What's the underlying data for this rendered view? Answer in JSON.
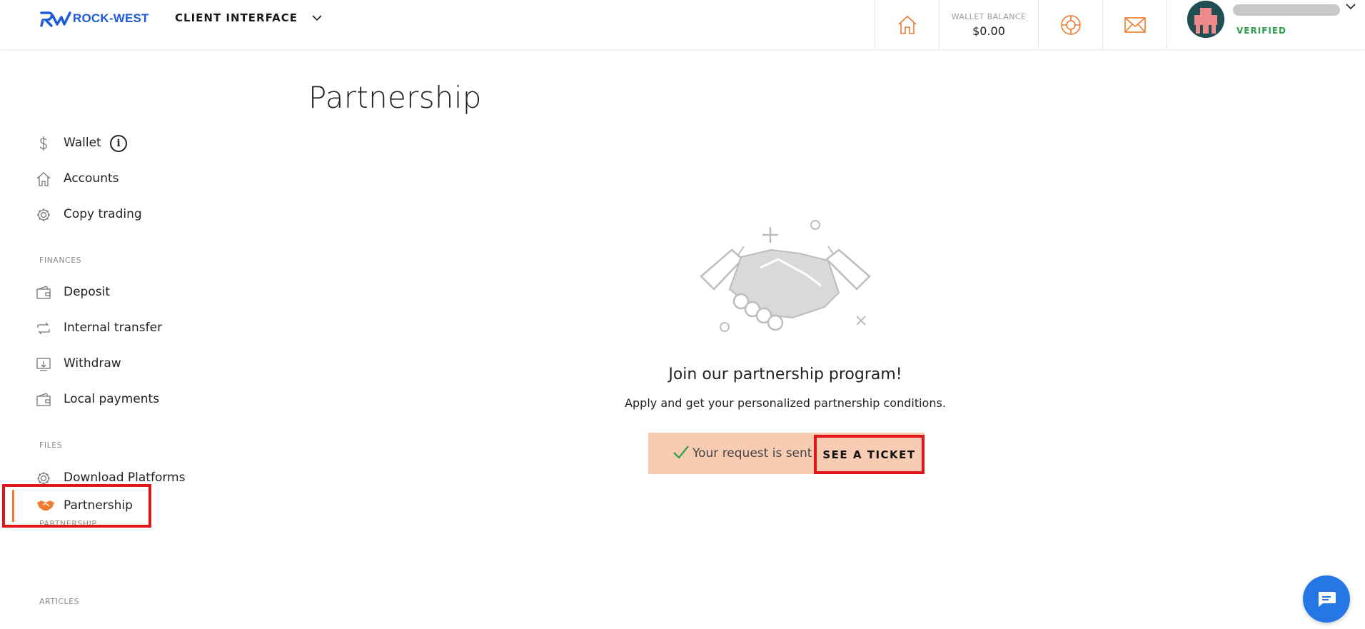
{
  "header": {
    "logo_text": "ROCK-WEST",
    "client_menu_label": "CLIENT INTERFACE",
    "wallet_label": "WALLET BALANCE",
    "wallet_value": "$0.00",
    "profile_status": "VERIFIED",
    "accent_color": "#f07a2e",
    "brand_color": "#1f5bd9"
  },
  "sidebar": {
    "items": [
      {
        "label": "Wallet",
        "icon": "dollar-icon"
      },
      {
        "label": "Accounts",
        "icon": "home-icon"
      },
      {
        "label": "Copy trading",
        "icon": "gear-icon"
      }
    ],
    "sections": {
      "finances": {
        "title": "FINANCES",
        "items": [
          {
            "label": "Deposit",
            "icon": "wallet-icon"
          },
          {
            "label": "Internal transfer",
            "icon": "transfer-icon"
          },
          {
            "label": "Withdraw",
            "icon": "withdraw-icon"
          },
          {
            "label": "Local payments",
            "icon": "wallet-icon"
          }
        ]
      },
      "files": {
        "title": "FILES",
        "items": [
          {
            "label": "Download Platforms",
            "icon": "gear-icon"
          }
        ]
      },
      "partnership": {
        "title": "PARTNERSHIP",
        "items": [
          {
            "label": "Partnership",
            "icon": "handshake-icon",
            "active": true
          }
        ]
      },
      "articles": {
        "title": "ARTICLES"
      }
    }
  },
  "main": {
    "title": "Partnership",
    "join_title": "Join our partnership program!",
    "join_subtitle": "Apply and get your personalized partnership conditions.",
    "banner_text": "Your request is sent",
    "ticket_button": "SEE A TICKET"
  }
}
